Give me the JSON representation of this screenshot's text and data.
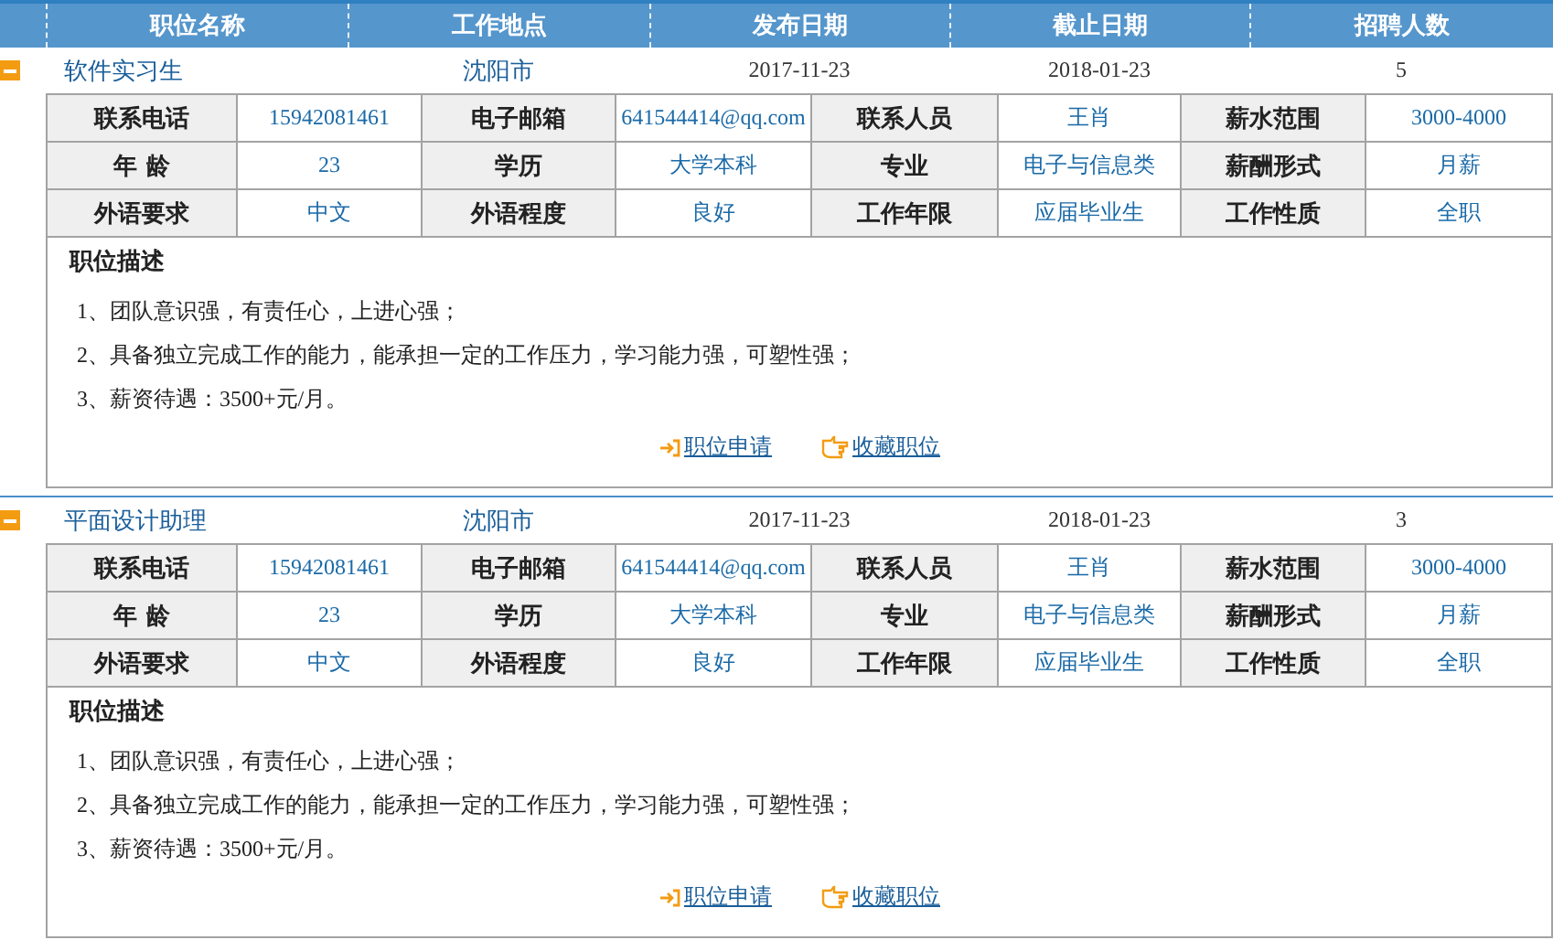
{
  "columns": [
    "职位名称",
    "工作地点",
    "发布日期",
    "截止日期",
    "招聘人数"
  ],
  "jobs": [
    {
      "expanded": true,
      "title": "软件实习生",
      "location": "沈阳市",
      "posted": "2017-11-23",
      "deadline": "2018-01-23",
      "count": "5",
      "details": [
        [
          {
            "label": "联系电话",
            "value": "15942081461"
          },
          {
            "label": "电子邮箱",
            "value": "641544414@qq.com"
          },
          {
            "label": "联系人员",
            "value": "王肖"
          },
          {
            "label": "薪水范围",
            "value": "3000-4000"
          }
        ],
        [
          {
            "label": "年 龄",
            "value": "23"
          },
          {
            "label": "学历",
            "value": "大学本科"
          },
          {
            "label": "专业",
            "value": "电子与信息类"
          },
          {
            "label": "薪酬形式",
            "value": "月薪"
          }
        ],
        [
          {
            "label": "外语要求",
            "value": "中文"
          },
          {
            "label": "外语程度",
            "value": "良好"
          },
          {
            "label": "工作年限",
            "value": "应届毕业生"
          },
          {
            "label": "工作性质",
            "value": "全职"
          }
        ]
      ],
      "description_title": "职位描述",
      "description": [
        "1、团队意识强，有责任心，上进心强；",
        "2、具备独立完成工作的能力，能承担一定的工作压力，学习能力强，可塑性强；",
        "3、薪资待遇：3500+元/月。"
      ],
      "actions": [
        {
          "kind": "apply",
          "label": "职位申请"
        },
        {
          "kind": "favorite",
          "label": "收藏职位"
        }
      ]
    },
    {
      "expanded": true,
      "title": "平面设计助理",
      "location": "沈阳市",
      "posted": "2017-11-23",
      "deadline": "2018-01-23",
      "count": "3",
      "details": [
        [
          {
            "label": "联系电话",
            "value": "15942081461"
          },
          {
            "label": "电子邮箱",
            "value": "641544414@qq.com"
          },
          {
            "label": "联系人员",
            "value": "王肖"
          },
          {
            "label": "薪水范围",
            "value": "3000-4000"
          }
        ],
        [
          {
            "label": "年 龄",
            "value": "23"
          },
          {
            "label": "学历",
            "value": "大学本科"
          },
          {
            "label": "专业",
            "value": "电子与信息类"
          },
          {
            "label": "薪酬形式",
            "value": "月薪"
          }
        ],
        [
          {
            "label": "外语要求",
            "value": "中文"
          },
          {
            "label": "外语程度",
            "value": "良好"
          },
          {
            "label": "工作年限",
            "value": "应届毕业生"
          },
          {
            "label": "工作性质",
            "value": "全职"
          }
        ]
      ],
      "description_title": "职位描述",
      "description": [
        "1、团队意识强，有责任心，上进心强；",
        "2、具备独立完成工作的能力，能承担一定的工作压力，学习能力强，可塑性强；",
        "3、薪资待遇：3500+元/月。"
      ],
      "actions": [
        {
          "kind": "apply",
          "label": "职位申请"
        },
        {
          "kind": "favorite",
          "label": "收藏职位"
        }
      ]
    }
  ]
}
